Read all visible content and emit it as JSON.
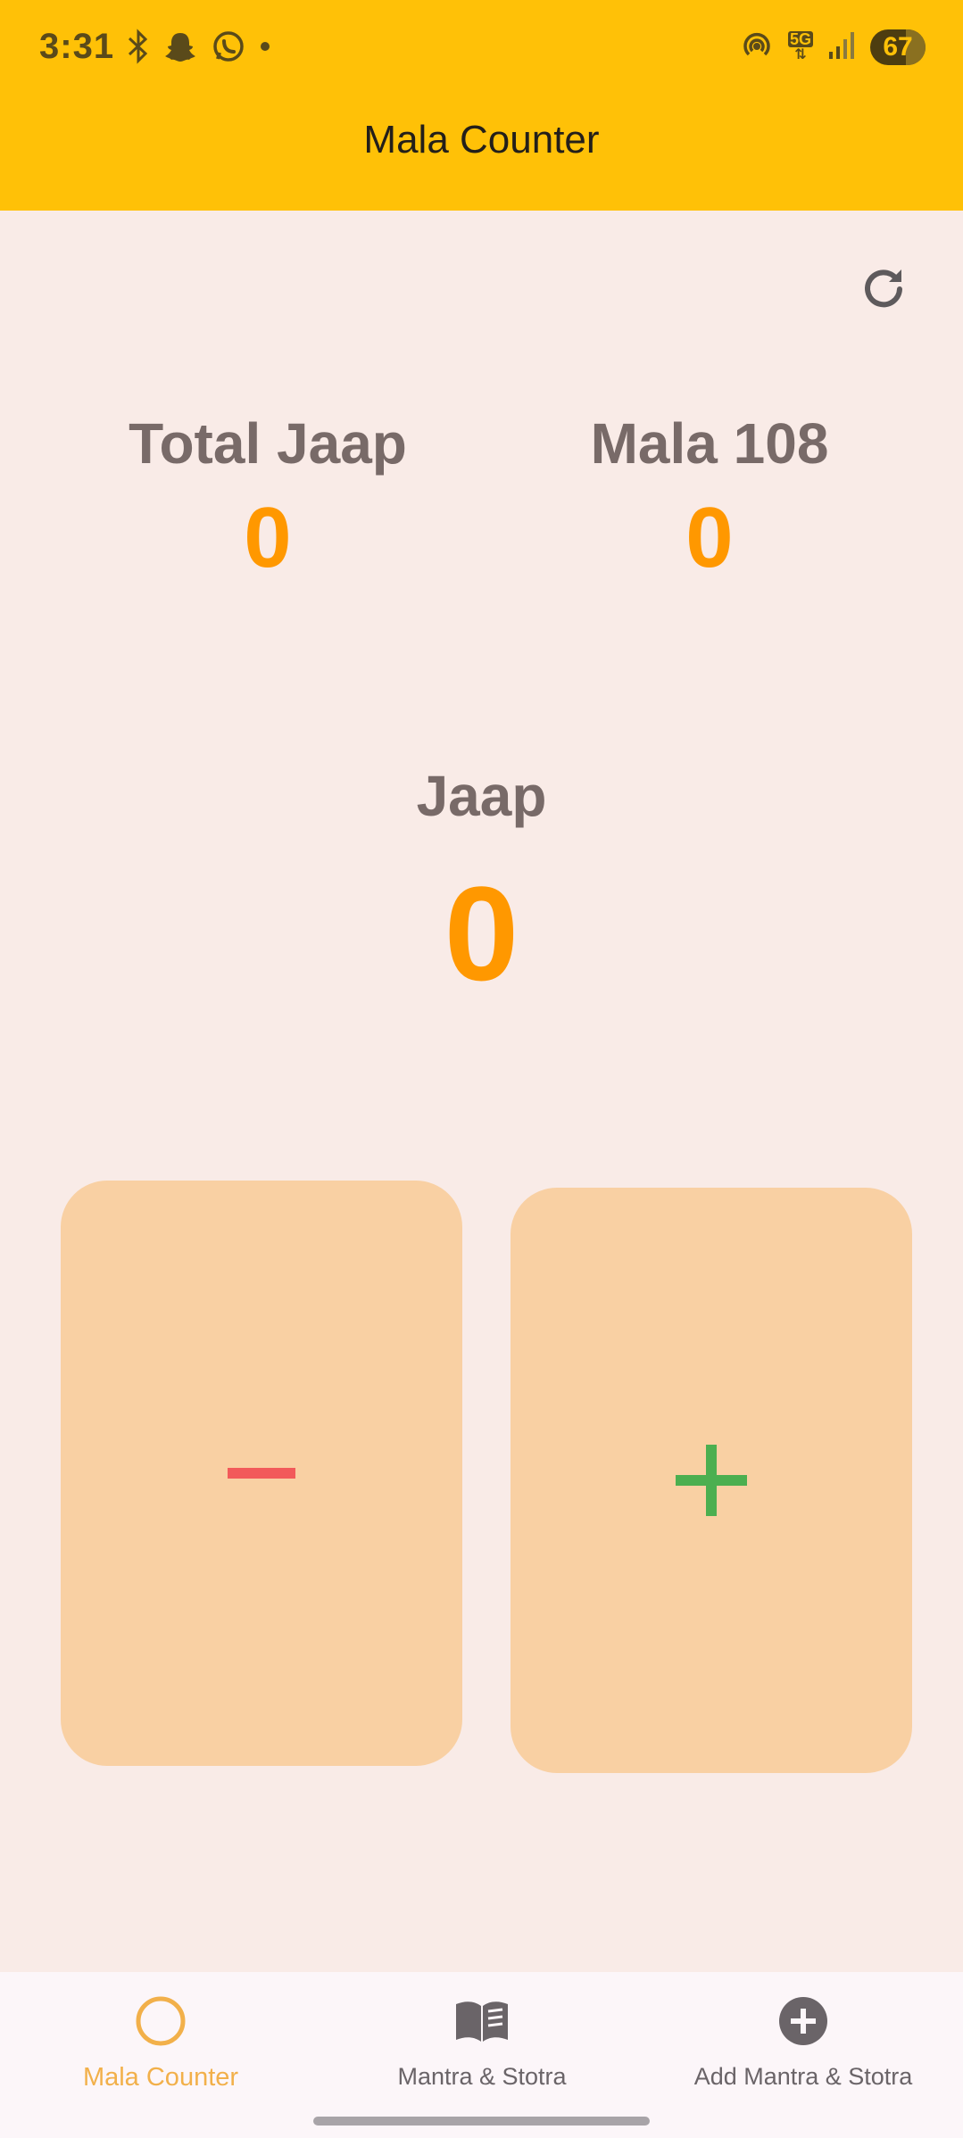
{
  "status_bar": {
    "time": "3:31",
    "network": "5G",
    "battery": "67",
    "left_icons": [
      "bluetooth-icon",
      "snapchat-icon",
      "whatsapp-icon",
      "dot-icon"
    ],
    "right_icons": [
      "hotspot-icon",
      "5g-icon",
      "signal-icon",
      "battery-icon"
    ]
  },
  "header": {
    "title": "Mala Counter"
  },
  "stats": {
    "total_label": "Total Jaap",
    "total_value": "0",
    "mala_label": "Mala 108",
    "mala_value": "0",
    "jaap_label": "Jaap",
    "jaap_value": "0"
  },
  "controls": {
    "reset_icon": "refresh-icon",
    "decrement_icon": "minus-icon",
    "increment_icon": "plus-icon"
  },
  "bottom_nav": {
    "items": [
      {
        "label": "Mala Counter",
        "icon": "circle-icon",
        "active": true
      },
      {
        "label": "Mantra & Stotra",
        "icon": "book-icon",
        "active": false
      },
      {
        "label": "Add Mantra & Stotra",
        "icon": "add-circle-icon",
        "active": false
      }
    ]
  },
  "colors": {
    "header_bg": "#ffc107",
    "page_bg": "#f9ebe7",
    "accent_value": "#ff9800",
    "label_gray": "#786a68",
    "button_bg": "#f9d0a3",
    "minus_color": "#f25a5a",
    "plus_color": "#4caf50",
    "nav_active": "#f2b04a"
  }
}
